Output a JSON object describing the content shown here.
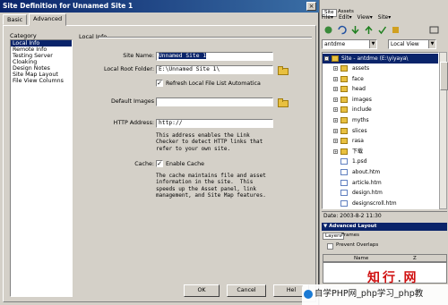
{
  "dialog": {
    "title": "Site Definition for Unnamed Site 1",
    "close_glyph": "×",
    "tabs": [
      "Basic",
      "Advanced"
    ],
    "category_label": "Category",
    "categories": [
      "Local Info",
      "Remote Info",
      "Testing Server",
      "Cloaking",
      "Design Notes",
      "Site Map Layout",
      "File View Columns"
    ],
    "section_title": "Local Info",
    "site_name_label": "Site Name:",
    "site_name_value": "Unnamed Site 1",
    "local_root_label": "Local Root Folder:",
    "local_root_value": "E:\\Unnamed Site 1\\",
    "refresh_label": "Refresh Local File List Automatica",
    "default_images_label": "Default Images",
    "default_images_value": "",
    "http_label": "HTTP Address:",
    "http_value": "http://",
    "http_note": "This address enables the Link\nChecker to detect HTTP links that\nrefer to your own site.",
    "cache_label": "Cache:",
    "enable_cache_label": "Enable Cache",
    "cache_note": "The cache maintains file and asset\ninformation in the site.  This\nspeeds up the Asset panel, link\nmanagement, and Site Map features.",
    "check_glyph": "✓",
    "ok_label": "OK",
    "cancel_label": "Cancel",
    "help_label": "Hel"
  },
  "panel": {
    "title": "▼ Files",
    "tabs": [
      "Site",
      "Assets"
    ],
    "menu": [
      "File▾",
      "Edit▾",
      "View▾",
      "Site▾"
    ],
    "site_select": "antdme",
    "view_select": "Local View",
    "root_label": "Site - antdme (E:\\yiyaya\\",
    "tree": [
      {
        "name": "assets",
        "type": "folder"
      },
      {
        "name": "face",
        "type": "folder"
      },
      {
        "name": "head",
        "type": "folder"
      },
      {
        "name": "images",
        "type": "folder"
      },
      {
        "name": "include",
        "type": "folder"
      },
      {
        "name": "myths",
        "type": "folder"
      },
      {
        "name": "slices",
        "type": "folder"
      },
      {
        "name": "rasa",
        "type": "folder"
      },
      {
        "name": "下载",
        "type": "folder"
      },
      {
        "name": "1.psd",
        "type": "file"
      },
      {
        "name": "about.htm",
        "type": "file"
      },
      {
        "name": "article.htm",
        "type": "file"
      },
      {
        "name": "design.htm",
        "type": "file"
      },
      {
        "name": "designscroll.htm",
        "type": "file"
      }
    ],
    "date": "Date: 2003-8-2 11:30",
    "advanced_layout": "▼ Advanced Layout",
    "adv_tabs": [
      "Layers",
      "Frames"
    ],
    "prevent_overlaps": "Prevent Overlaps",
    "layers_cols": [
      "",
      "Name",
      "Z"
    ]
  },
  "watermark": {
    "logo_a": "知",
    "logo_b": "行",
    "logo_dot": ".",
    "logo_c": "网",
    "text": "自学PHP网_php学习_php教"
  }
}
